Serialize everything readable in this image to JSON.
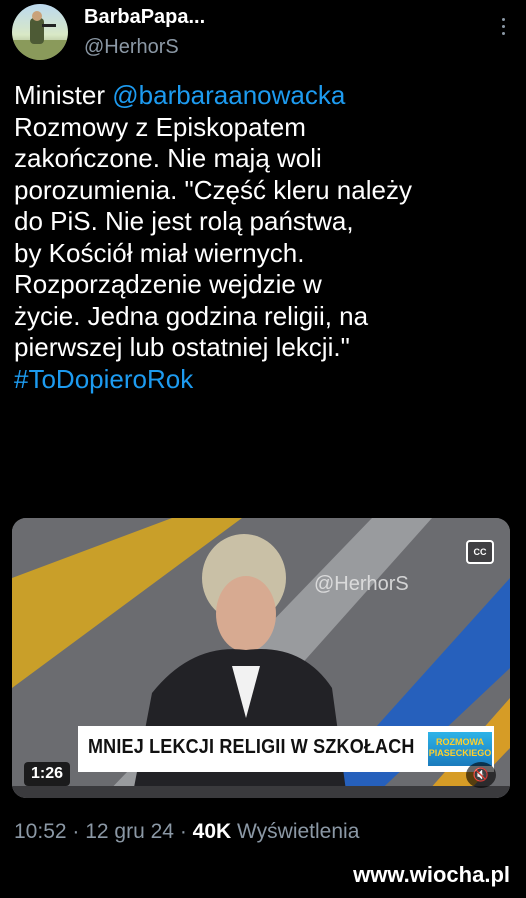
{
  "author": {
    "display_name": "BarbaPapa...",
    "handle": "@HerhorS"
  },
  "tweet": {
    "prefix": "Minister ",
    "mention": "@barbaraanowacka",
    "body": "\nRozmowy z Episkopatem\nzakończone. Nie mają woli\nporozumienia. \"Część kleru należy\ndo PiS. Nie jest rolą państwa,\nby Kościół miał wiernych.\nRozporządzenie wejdzie w\nżycie. Jedna godzina religii, na\npierwszej lub ostatniej lekcji.\"\n",
    "hashtag": "#ToDopieroRok"
  },
  "video": {
    "watermark": "@HerhorS",
    "cc_label": "CC",
    "lower_third": "MNIEJ LEKCJI RELIGII W SZKOŁACH",
    "show_logo_line1": "ROZMOWA",
    "show_logo_line2": "PIASECKIEGO",
    "duration": "1:26",
    "mute_icon": "speaker-muted-icon"
  },
  "meta": {
    "time": "10:52",
    "sep1": " · ",
    "date": "12 gru 24",
    "sep2": " · ",
    "views": "40K",
    "views_label": " Wyświetlenia"
  },
  "site_watermark": "www.wiocha.pl",
  "colors": {
    "background": "#000000",
    "text": "#ffffff",
    "secondary": "#8b98a5",
    "link": "#1d9bf0"
  }
}
